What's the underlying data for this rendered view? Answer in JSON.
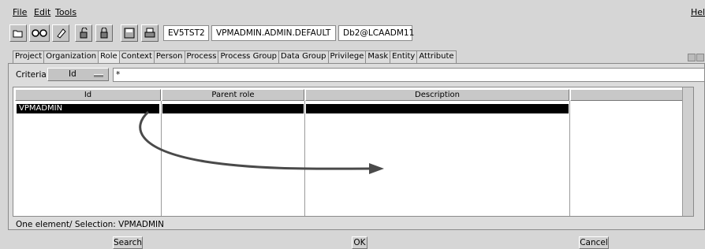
{
  "menu": {
    "file": "File",
    "edit": "Edit",
    "tools": "Tools",
    "help": "Help"
  },
  "toolbar": {
    "icons": [
      "open-folder-icon",
      "glasses-icon",
      "eraser-icon",
      "unlock-icon",
      "lock-icon",
      "save-icon",
      "print-icon"
    ],
    "env": "EV5TST2",
    "context": "VPMADMIN.ADMIN.DEFAULT",
    "database": "Db2@LCAADM11"
  },
  "tabs": [
    "Project",
    "Organization",
    "Role",
    "Context",
    "Person",
    "Process",
    "Process Group",
    "Data Group",
    "Privilege",
    "Mask",
    "Entity",
    "Attribute"
  ],
  "active_tab": "Role",
  "criteria": {
    "label": "Criteria:",
    "field": "Id",
    "value": "*"
  },
  "table": {
    "headers": [
      "Id",
      "Parent role",
      "Description",
      ""
    ],
    "rows": [
      {
        "id": "VPMADMIN",
        "parent": "",
        "description": ""
      }
    ]
  },
  "status": "One element/ Selection: VPMADMIN",
  "buttons": {
    "search": "Search",
    "ok": "OK",
    "cancel": "Cancel"
  }
}
